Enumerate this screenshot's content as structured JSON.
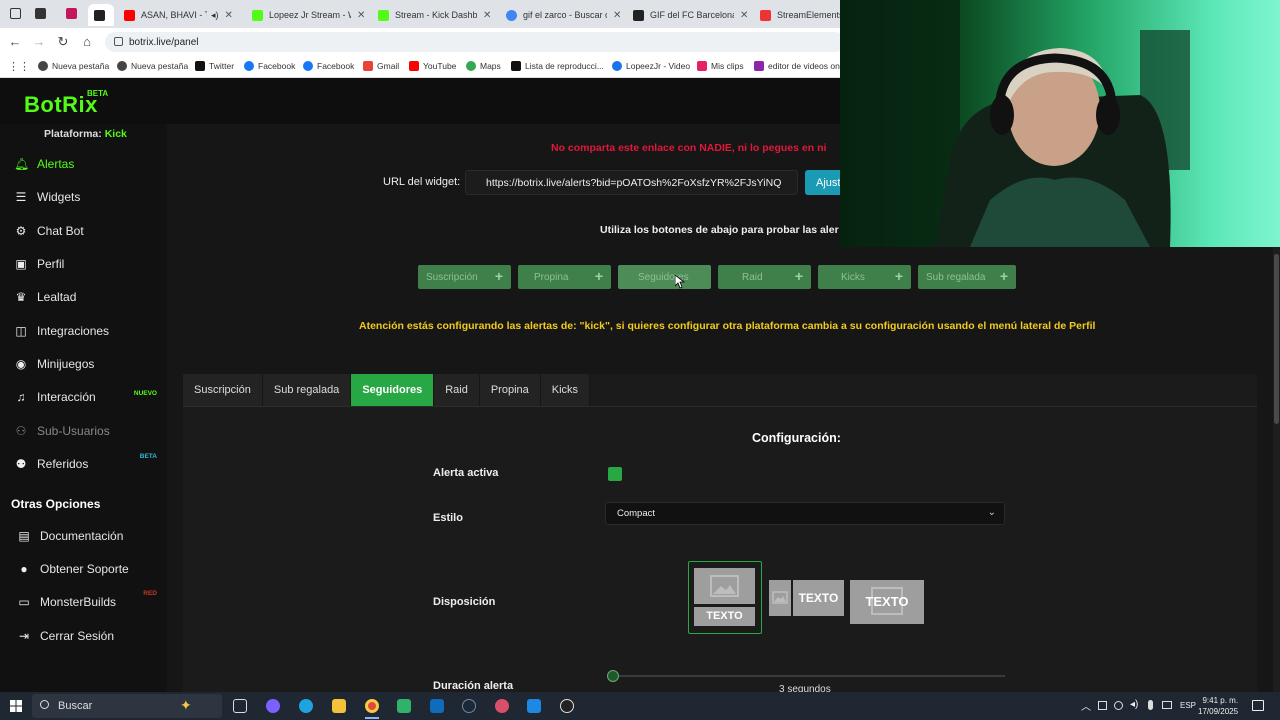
{
  "browser": {
    "tabs": [
      {
        "label": "ASAN, BHAVI - TE",
        "fav": "#ff0000",
        "active": false
      },
      {
        "label": "Lopeez Jr Stream - Wa",
        "fav": "#53fc18",
        "active": false
      },
      {
        "label": "Stream - Kick Dashbo",
        "fav": "#53fc18",
        "active": false
      },
      {
        "label": "gif el zarco - Buscar co",
        "fav": "#4285f4",
        "active": false
      },
      {
        "label": "GIF del FC Barcelona ti",
        "fav": "#c00",
        "active": false
      },
      {
        "label": "StreamElements -",
        "fav": "#e33",
        "active": false
      }
    ],
    "url": "botrix.live/panel",
    "bookmarks": [
      "Nueva pestaña",
      "Nueva pestaña",
      "Twitter",
      "Facebook",
      "Facebook",
      "Gmail",
      "YouTube",
      "Maps",
      "Lista de reproducci...",
      "LopeezJr - Video",
      "Mis clips",
      "editor de videos onl"
    ]
  },
  "app": {
    "logo": "BotRix",
    "logo_badge": "BETA",
    "platform_label": "Plataforma:",
    "platform_value": "Kick",
    "sidebar": {
      "items": [
        {
          "label": "Alertas",
          "icon": "bell-icon"
        },
        {
          "label": "Widgets",
          "icon": "list-icon"
        },
        {
          "label": "Chat Bot",
          "icon": "robot-icon"
        },
        {
          "label": "Perfil",
          "icon": "id-card-icon"
        },
        {
          "label": "Lealtad",
          "icon": "trophy-icon"
        },
        {
          "label": "Integraciones",
          "icon": "integrations-icon"
        },
        {
          "label": "Minijuegos",
          "icon": "gamepad-icon"
        },
        {
          "label": "Interacción",
          "icon": "music-icon",
          "tag": "NUEVO"
        },
        {
          "label": "Sub-Usuarios",
          "icon": "users-icon"
        },
        {
          "label": "Referidos",
          "icon": "referrals-icon",
          "tag": "BETA"
        }
      ],
      "section_title": "Otras Opciones",
      "other_items": [
        {
          "label": "Documentación",
          "icon": "book-icon"
        },
        {
          "label": "Obtener Soporte",
          "icon": "support-icon"
        },
        {
          "label": "MonsterBuilds",
          "icon": "monitor-icon",
          "tag": "RED"
        },
        {
          "label": "Cerrar Sesión",
          "icon": "logout-icon"
        }
      ]
    },
    "warning_red": "No comparta este enlace con NADIE, ni lo pegues en ni",
    "widget_url_label": "URL del widget:",
    "widget_url": "https://botrix.live/alerts?bid=pOATOsh%2FoXsfzYR%2FJsYiNQ",
    "adjust_button": "Ajust",
    "use_buttons_text": "Utiliza los botones de abajo para probar las aler",
    "test_buttons": [
      "Suscripción",
      "Propina",
      "Seguidores",
      "Raid",
      "Kicks",
      "Sub regalada"
    ],
    "attention": "Atención estás configurando las alertas de: \"kick\", si quieres configurar otra plataforma cambia a su configuración usando el menú lateral de Perfil",
    "tabs": [
      "Suscripción",
      "Sub regalada",
      "Seguidores",
      "Raid",
      "Propina",
      "Kicks"
    ],
    "active_tab": "Seguidores",
    "config_title": "Configuración:",
    "fields": {
      "alerta_activa": "Alerta activa",
      "estilo": "Estilo",
      "estilo_value": "Compact",
      "disposicion": "Disposición",
      "duracion": "Duración alerta",
      "duracion_value": "3 segundos"
    },
    "layout_text": "TEXTO",
    "alert_active": true
  },
  "taskbar": {
    "search_placeholder": "Buscar",
    "lang": "ESP",
    "time": "9:41 p. m.",
    "date": "17/09/2025"
  },
  "colors": {
    "kick_green": "#53fc18",
    "active_tab": "#28a745",
    "warning_red": "#e0183a",
    "attention_yellow": "#f2cb1d",
    "adjust_blue": "#1a9bb3"
  }
}
